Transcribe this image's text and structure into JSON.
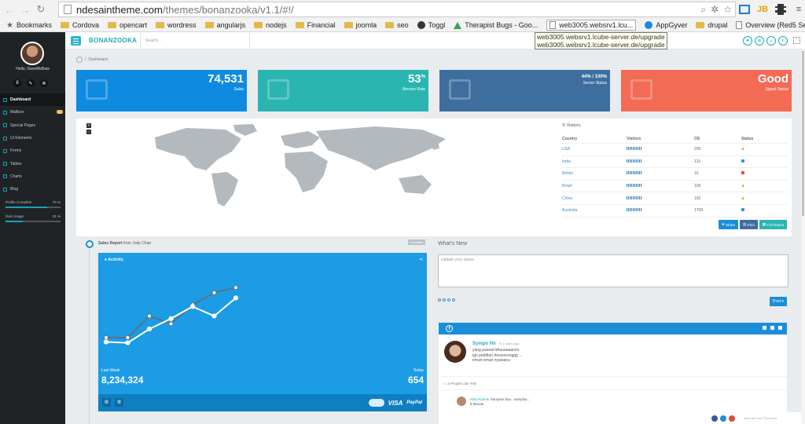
{
  "browser": {
    "url_host": "ndesaintheme.com",
    "url_path": "/themes/bonanzooka/v1.1/#!/",
    "bookmarks_label": "Bookmarks",
    "bookmarks": [
      {
        "icon": "folder-icon",
        "label": "Cordova"
      },
      {
        "icon": "folder-icon",
        "label": "opencart"
      },
      {
        "icon": "folder-icon",
        "label": "wordress"
      },
      {
        "icon": "folder-icon",
        "label": "angularjs"
      },
      {
        "icon": "folder-icon",
        "label": "nodejs"
      },
      {
        "icon": "folder-icon",
        "label": "Financial"
      },
      {
        "icon": "folder-icon",
        "label": "joomla"
      },
      {
        "icon": "folder-icon",
        "label": "seo"
      },
      {
        "icon": "toggl-icon",
        "label": "Toggl"
      },
      {
        "icon": "drive-icon",
        "label": "Therapist Bugs - Goo..."
      },
      {
        "icon": "page-icon",
        "label": "web3005.websrv1.lcu..."
      },
      {
        "icon": "globe-icon",
        "label": "AppGyver"
      },
      {
        "icon": "folder-icon",
        "label": "drupal"
      },
      {
        "icon": "page-icon",
        "label": "Overview (Red5 Serve..."
      }
    ],
    "tooltip": [
      "web3005.websrv1.lcube-server.de/upgrade",
      "web3005.websrv1.lcube-server.de/upgrade"
    ],
    "jb_label": "JB"
  },
  "sidebar": {
    "greeting": "Hello, DaveMeBaw",
    "icon_8": "8",
    "menu": [
      {
        "label": "Dashboard",
        "active": true
      },
      {
        "label": "Mailbox",
        "badge": "11"
      },
      {
        "label": "Special Pages"
      },
      {
        "label": "UI Elements"
      },
      {
        "label": "Forms"
      },
      {
        "label": "Tables"
      },
      {
        "label": "Charts"
      },
      {
        "label": "Blog"
      }
    ],
    "profile": {
      "label": "Profile Complete",
      "value": "76 %",
      "fraction": 0.76
    },
    "disk": {
      "label": "Disk Usage",
      "value": "31 %",
      "fraction": 0.31
    }
  },
  "appbar": {
    "brand": "BONANZOOKA",
    "search_placeholder": "Search..."
  },
  "breadcrumb": "Dashboard",
  "stats": [
    {
      "value": "74,531",
      "label": "Sales",
      "color": "#0e8be0"
    },
    {
      "value": "53",
      "suffix": "%",
      "label": "Bounce Rate",
      "color": "#2ab5b1"
    },
    {
      "value": "44% / 100%",
      "label": "Server Status",
      "color": "#3d6e9e"
    },
    {
      "value": "Good",
      "label": "Signal Status",
      "color": "#f26b55"
    }
  ],
  "visitors": {
    "title": "Visitors",
    "headers": [
      "Country",
      "Visitors",
      "OS",
      "Status"
    ],
    "rows": [
      {
        "country": "USA",
        "os": "205",
        "status": "warn"
      },
      {
        "country": "India",
        "os": "131",
        "status": "up"
      },
      {
        "country": "Britain",
        "os": "15",
        "status": "down"
      },
      {
        "country": "Brazil",
        "os": "109",
        "status": "warn"
      },
      {
        "country": "China",
        "os": "192",
        "status": "warn"
      },
      {
        "country": "Australia",
        "os": "1709",
        "status": "up"
      }
    ],
    "buttons": [
      {
        "label": "Share",
        "color": "#1b8ed8"
      },
      {
        "label": "Print",
        "color": "#3d6e9e"
      },
      {
        "label": "Full Report",
        "color": "#2ab5b1"
      }
    ]
  },
  "sales": {
    "title_bold": "Sales Report",
    "title_rest": "from Jody Chan",
    "badge": "Available",
    "activity_title": "Activity",
    "last_week_label": "Last Week",
    "last_week_value": "8,234,324",
    "today_label": "Today",
    "today_value": "654",
    "payment_visa": "VISA",
    "payment_paypal": "PayPal"
  },
  "chart_data": {
    "type": "line",
    "x": [
      1,
      2,
      3,
      4,
      5,
      6,
      7
    ],
    "series": [
      {
        "values": [
          0.2,
          0.2,
          0.45,
          0.36,
          0.58,
          0.72,
          0.78
        ],
        "color": "#5e6f86"
      },
      {
        "values": [
          0.15,
          0.14,
          0.3,
          0.42,
          0.56,
          0.45,
          0.66
        ],
        "color": "#ffffff"
      }
    ],
    "ylim": [
      0,
      1
    ],
    "grid": false
  },
  "whats_new": {
    "title": "What's New",
    "placeholder": "Update your status",
    "post_label": "Post"
  },
  "feed": {
    "name": "Sympo Ho",
    "ago": "1 hours ago",
    "text": [
      "yang pasaal lelluuaaaannn",
      "ign peddlan doooooonggg ...",
      "eman eman nyawanu"
    ],
    "likes": "2 People Like This",
    "commenter": "Kitta Ryanto",
    "comment": "Samplus buu...samplus...",
    "comment_time": "5 Minute"
  },
  "footer": {
    "made": "Made with love Themsonite"
  }
}
